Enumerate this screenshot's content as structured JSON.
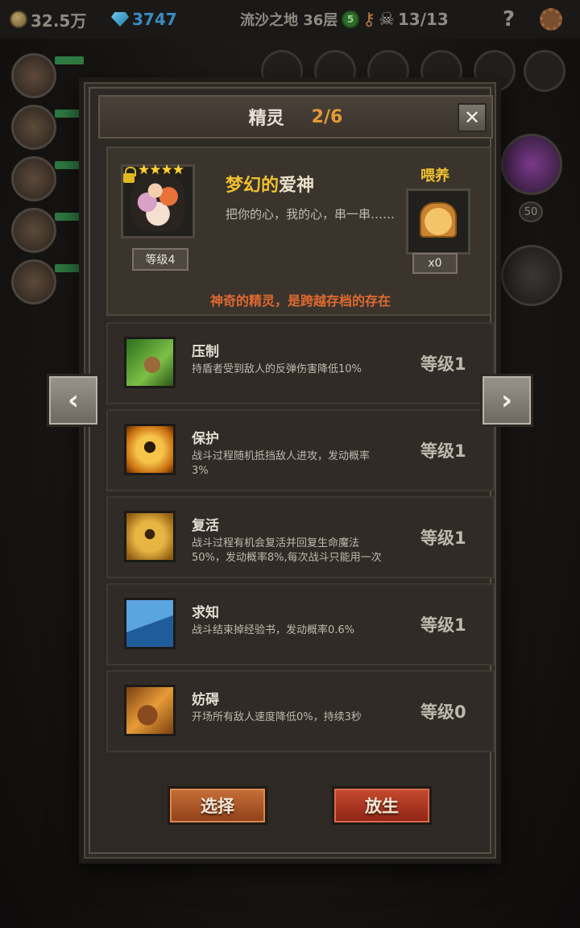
{
  "topbar": {
    "gold": "32.5万",
    "gems": "3747",
    "location": "流沙之地 36层",
    "green_badge": "5",
    "skull_count": "13/13",
    "help": "?"
  },
  "background": {
    "orb_level": "50"
  },
  "dialog": {
    "title": "精灵",
    "page_count": "2/6",
    "close_label": "✕",
    "sprite": {
      "stars": "★★★★",
      "level_tag": "等级4",
      "name_part1": "梦幻的",
      "name_part2": "爱神",
      "description": "把你的心，我的心，串一串……",
      "feed_label": "喂养",
      "feed_count": "x0",
      "tagline": "神奇的精灵，是跨越存档的存在"
    },
    "skills": [
      {
        "name": "压制",
        "desc": "持盾者受到敌人的反弹伤害降低10%",
        "level": "等级1",
        "icon": "claw-icon"
      },
      {
        "name": "保护",
        "desc": "战斗过程随机抵挡敌人进攻，发动概率3%",
        "level": "等级1",
        "icon": "shield-spirit-icon"
      },
      {
        "name": "复活",
        "desc": "战斗过程有机会复活并回复生命魔法50%，发动概率8%,每次战斗只能用一次",
        "level": "等级1",
        "icon": "revive-icon"
      },
      {
        "name": "求知",
        "desc": "战斗结束掉经验书，发动概率0.6%",
        "level": "等级1",
        "icon": "book-icon"
      },
      {
        "name": "妨碍",
        "desc": "开场所有敌人速度降低0%，持续3秒",
        "level": "等级0",
        "icon": "chained-boot-icon"
      }
    ],
    "buttons": {
      "select": "选择",
      "release": "放生"
    }
  },
  "nav": {
    "prev": "‹",
    "next": "›"
  }
}
